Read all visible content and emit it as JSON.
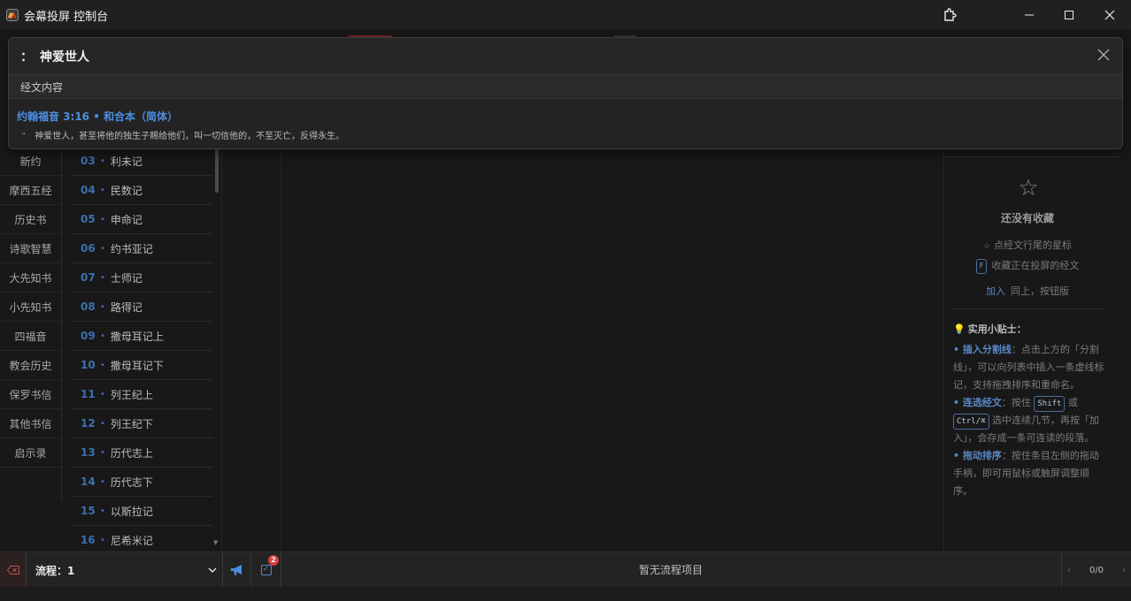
{
  "window": {
    "title": "会幕投屏 控制台",
    "logo_icon": "tent-icon",
    "ext_icon": "puzzle-icon"
  },
  "categories": [
    "新约",
    "摩西五经",
    "历史书",
    "诗歌智慧",
    "大先知书",
    "小先知书",
    "四福音",
    "教会历史",
    "保罗书信",
    "其他书信",
    "启示录"
  ],
  "books": [
    {
      "num": "03",
      "name": "利未记"
    },
    {
      "num": "04",
      "name": "民数记"
    },
    {
      "num": "05",
      "name": "申命记"
    },
    {
      "num": "06",
      "name": "约书亚记"
    },
    {
      "num": "07",
      "name": "士师记"
    },
    {
      "num": "08",
      "name": "路得记"
    },
    {
      "num": "09",
      "name": "撒母耳记上"
    },
    {
      "num": "10",
      "name": "撒母耳记下"
    },
    {
      "num": "11",
      "name": "列王纪上"
    },
    {
      "num": "12",
      "name": "列王纪下"
    },
    {
      "num": "13",
      "name": "历代志上"
    },
    {
      "num": "14",
      "name": "历代志下"
    },
    {
      "num": "15",
      "name": "以斯拉记"
    },
    {
      "num": "16",
      "name": "尼希米记"
    }
  ],
  "favorites": {
    "empty_title": "还没有收藏",
    "hint1": "点经文行尾的星标",
    "hint2_key": "F",
    "hint2": "收藏正在投屏的经文",
    "hint3_word": "加入",
    "hint3": "同上，按钮版"
  },
  "tips": {
    "title": "实用小贴士：",
    "t1_key": "• 插入分割线",
    "t1_text": "：点击上方的「分割线」，可以向列表中插入一条虚线标记，支持拖拽排序和重命名。",
    "t2_key": "• 连选经文",
    "t2_a": "：按住",
    "t2_kbd1": "Shift",
    "t2_b": "或",
    "t2_kbd2": "Ctrl/⌘",
    "t2_c": "选中连续几节，再按「加入」，会存成一条可连读的段落。",
    "t3_key": "• 拖动排序",
    "t3_text": "：按住条目左侧的拖动手柄，即可用鼠标或触屏调整顺序。"
  },
  "bottombar": {
    "flow_label": "流程：1",
    "badge_count": "2",
    "empty_text": "暂无流程项目",
    "pager": "0/0"
  },
  "popup": {
    "colon": "：",
    "query": "神爱世人",
    "section": "经文内容",
    "result_ref": "约翰福音 3:16 • 和合本（简体）",
    "result_quote": "”",
    "result_text": "神爱世人，甚至将他的独生子赐给他们，叫一切信他的，不至灭亡，反得永生。"
  },
  "colors": {
    "accent_blue": "#4a8ee0",
    "danger_red": "#d94040",
    "background": "#181818"
  }
}
